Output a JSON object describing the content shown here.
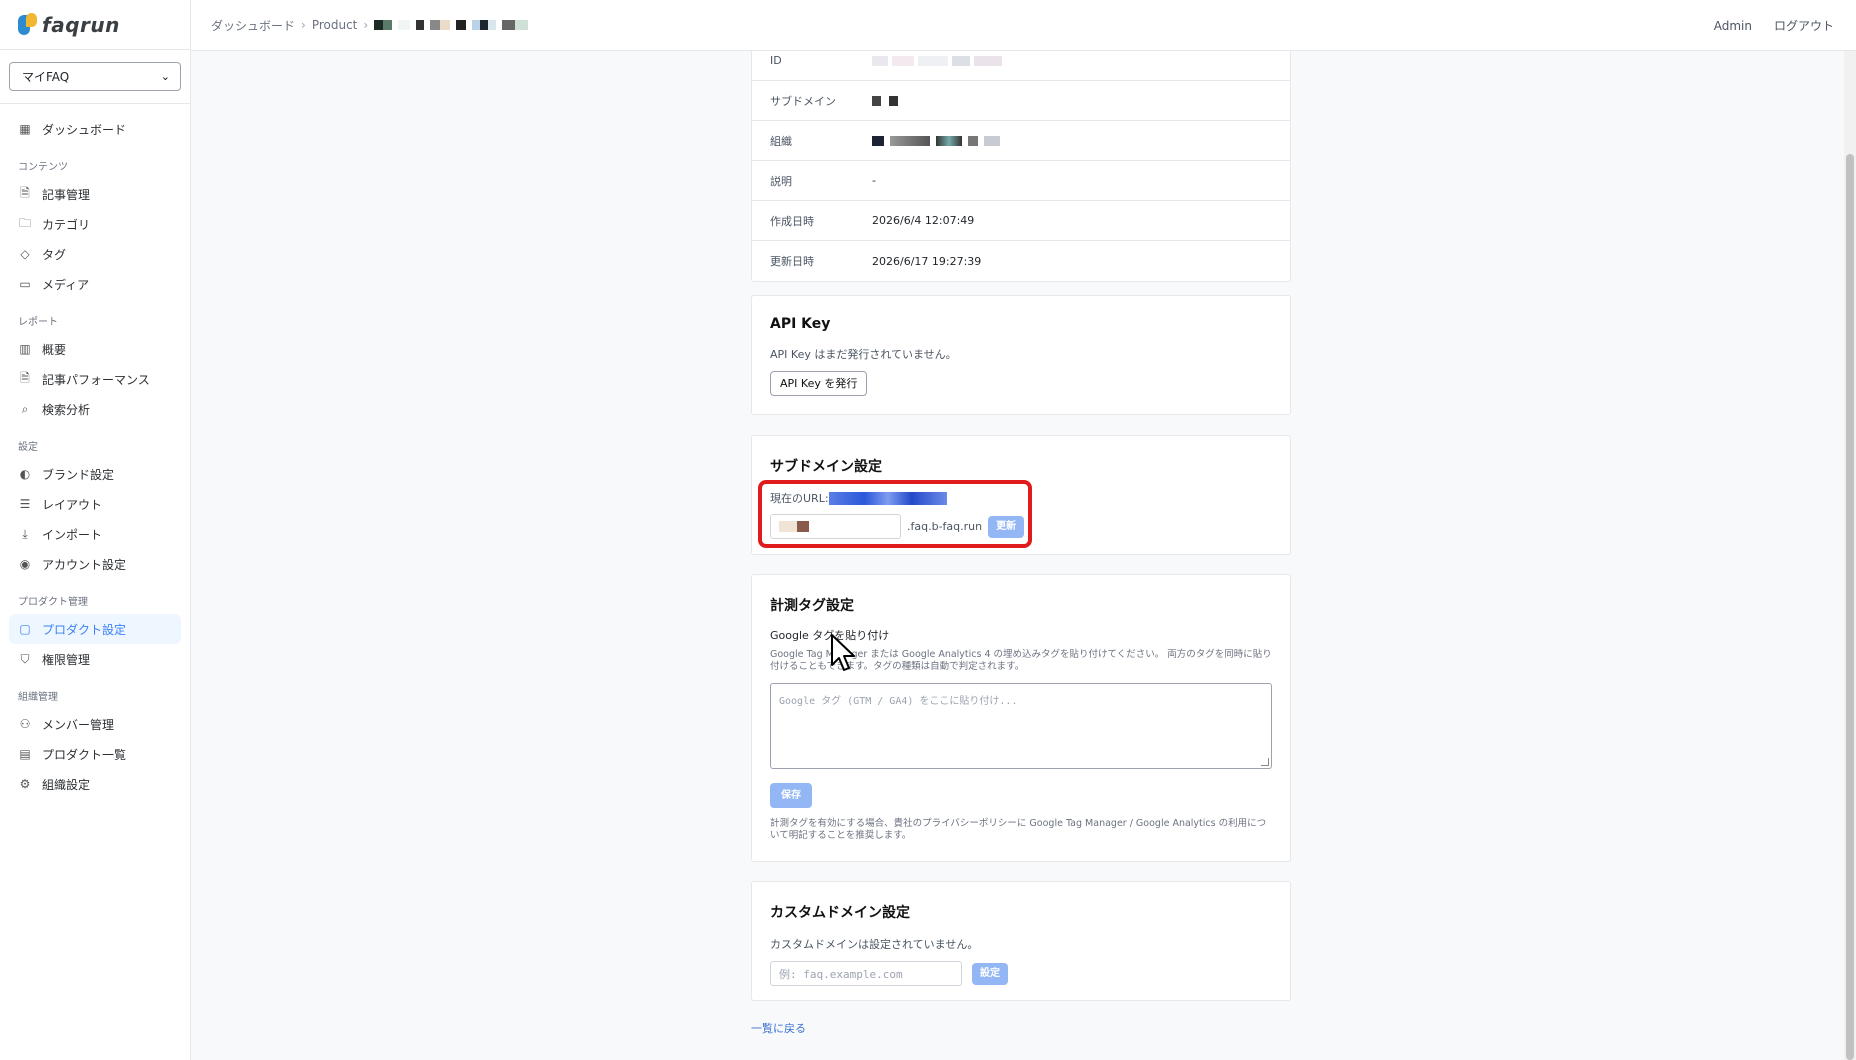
{
  "brand": {
    "name": "faqrun"
  },
  "sidebar": {
    "selector_value": "マイFAQ",
    "sections": [
      {
        "items": [
          {
            "label": "ダッシュボード",
            "icon": "grid-icon"
          }
        ]
      },
      {
        "title": "コンテンツ",
        "items": [
          {
            "label": "記事管理",
            "icon": "document-icon"
          },
          {
            "label": "カテゴリ",
            "icon": "folder-icon"
          },
          {
            "label": "タグ",
            "icon": "tag-icon"
          },
          {
            "label": "メディア",
            "icon": "image-icon"
          }
        ]
      },
      {
        "title": "レポート",
        "items": [
          {
            "label": "概要",
            "icon": "bar-chart-icon"
          },
          {
            "label": "記事パフォーマンス",
            "icon": "document-chart-icon"
          },
          {
            "label": "検索分析",
            "icon": "search-icon"
          }
        ]
      },
      {
        "title": "設定",
        "items": [
          {
            "label": "ブランド設定",
            "icon": "palette-icon"
          },
          {
            "label": "レイアウト",
            "icon": "layout-icon"
          },
          {
            "label": "インポート",
            "icon": "download-icon"
          },
          {
            "label": "アカウント設定",
            "icon": "user-circle-icon"
          }
        ]
      },
      {
        "title": "プロダクト管理",
        "items": [
          {
            "label": "プロダクト設定",
            "icon": "box-icon",
            "active": true
          },
          {
            "label": "権限管理",
            "icon": "shield-icon"
          }
        ]
      },
      {
        "title": "組織管理",
        "items": [
          {
            "label": "メンバー管理",
            "icon": "users-icon"
          },
          {
            "label": "プロダクト一覧",
            "icon": "building-icon"
          },
          {
            "label": "組織設定",
            "icon": "gear-icon"
          }
        ]
      }
    ]
  },
  "topbar": {
    "breadcrumb": [
      "ダッシュボード",
      "Product"
    ],
    "admin": "Admin",
    "logout": "ログアウト"
  },
  "info": {
    "rows": [
      {
        "key": "ID",
        "value": ""
      },
      {
        "key": "サブドメイン",
        "value": ""
      },
      {
        "key": "組織",
        "value": ""
      },
      {
        "key": "説明",
        "value": "-"
      },
      {
        "key": "作成日時",
        "value": "2026/6/4 12:07:49"
      },
      {
        "key": "更新日時",
        "value": "2026/6/17 19:27:39"
      }
    ]
  },
  "api_key": {
    "title": "API Key",
    "status": "API Key はまだ発行されていません。",
    "button": "API Key を発行"
  },
  "subdomain": {
    "title": "サブドメイン設定",
    "current_url_label": "現在のURL:",
    "suffix": ".faq.b-faq.run",
    "button": "更新"
  },
  "tracking": {
    "title": "計測タグ設定",
    "label": "Google タグを貼り付け",
    "help": "Google Tag Manager または Google Analytics 4 の埋め込みタグを貼り付けてください。 両方のタグを同時に貼り付けることもできます。タグの種類は自動で判定されます。",
    "placeholder": "Google タグ (GTM / GA4) をここに貼り付け...",
    "button": "保存",
    "note": "計測タグを有効にする場合、貴社のプライバシーポリシーに Google Tag Manager / Google Analytics の利用について明記することを推奨します。"
  },
  "custom_domain": {
    "title": "カスタムドメイン設定",
    "status": "カスタムドメインは設定されていません。",
    "placeholder": "例: faq.example.com",
    "button": "設定"
  },
  "back_link": "一覧に戻る",
  "colors": {
    "accent": "#3b82f6",
    "highlight": "#e01b1b",
    "button_disabled": "#93b7f5"
  }
}
